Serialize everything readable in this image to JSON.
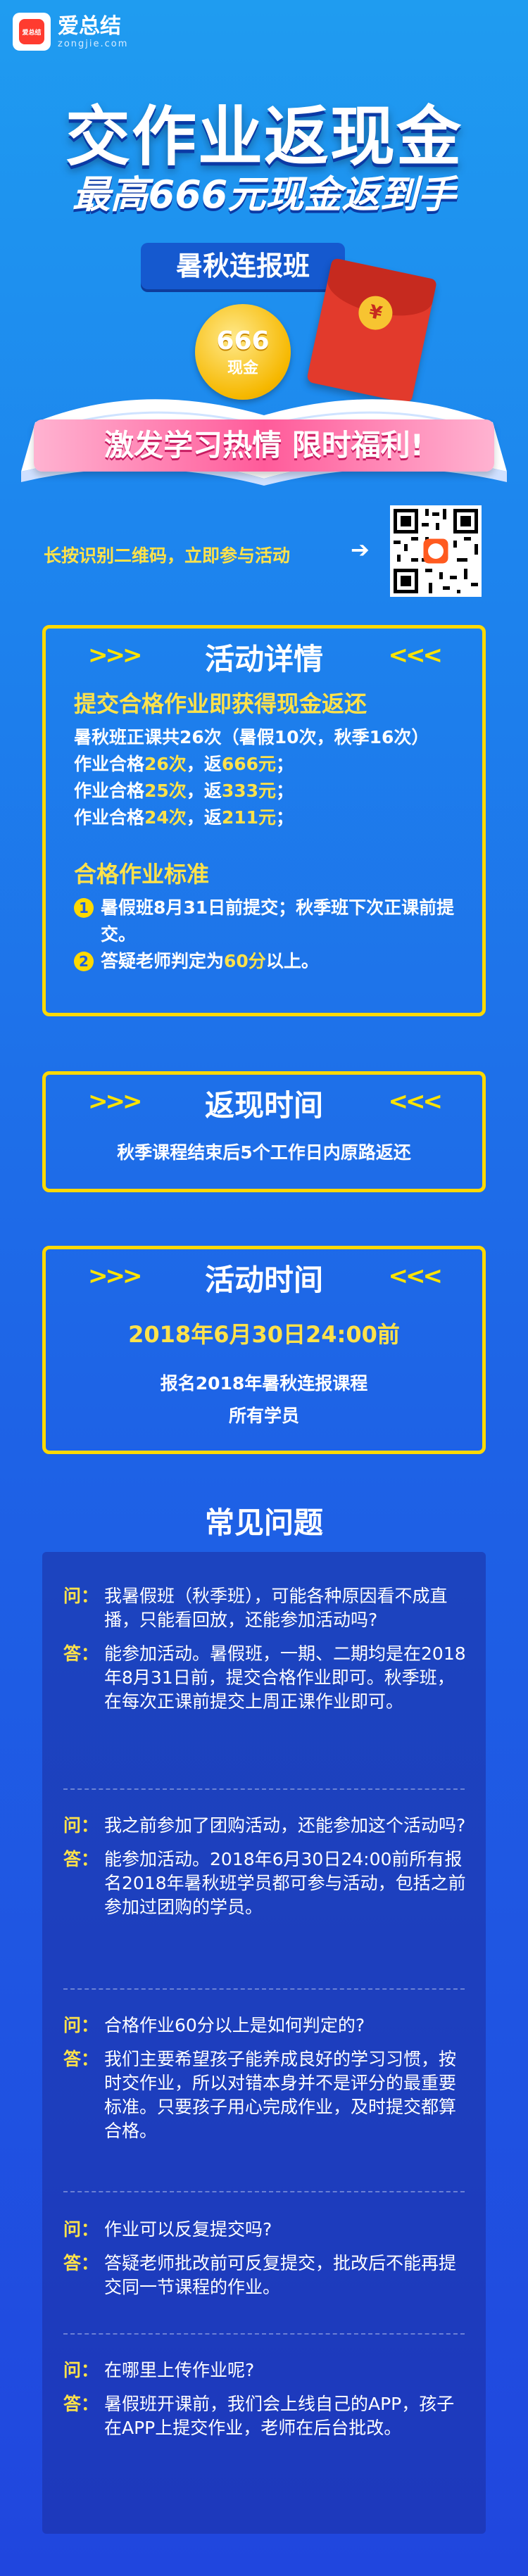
{
  "brand": {
    "name": "爱总结",
    "domain": "zongjie.com",
    "badge": "爱总结"
  },
  "hero": {
    "title": "交作业返现金",
    "subtitle": "最高666元现金返到手",
    "class_tag": "暑秋连报班",
    "coin_amount": "666",
    "coin_unit": "现金",
    "envelope_symbol": "¥",
    "banner": "激发学习热情  限时福利!"
  },
  "qr_prompt": {
    "text": "长按识别二维码，立即参与活动",
    "arrow": "➔"
  },
  "activity": {
    "title": "活动详情",
    "h1": "提交合格作业即获得现金返还",
    "lines": [
      {
        "pre": "暑秋班正课共26次（暑假10次，秋季16次）"
      },
      {
        "pre": "作业合格",
        "a": "26次",
        "mid": "，返",
        "b": "666元",
        "post": "；"
      },
      {
        "pre": "作业合格",
        "a": "25次",
        "mid": "，返",
        "b": "333元",
        "post": "；"
      },
      {
        "pre": "作业合格",
        "a": "24次",
        "mid": "，返",
        "b": "211元",
        "post": "；"
      }
    ],
    "h2": "合格作业标准",
    "rules": [
      {
        "n": "1",
        "text": "暑假班8月31日前提交；秋季班下次正课前提交。"
      },
      {
        "n": "2",
        "pre": "答疑老师判定为",
        "hl": "60分",
        "post": "以上。"
      }
    ]
  },
  "refund": {
    "title": "返现时间",
    "text": "秋季课程结束后5个工作日内原路返还"
  },
  "period": {
    "title": "活动时间",
    "deadline": "2018年6月30日24:00前",
    "l1": "报名2018年暑秋连报课程",
    "l2": "所有学员"
  },
  "faq": {
    "title": "常见问题",
    "q_label": "问：",
    "a_label": "答：",
    "items": [
      {
        "q": "我暑假班（秋季班），可能各种原因看不成直播，只能看回放，还能参加活动吗?",
        "a": "能参加活动。暑假班，一期、二期均是在2018年8月31日前，提交合格作业即可。秋季班，在每次正课前提交上周正课作业即可。"
      },
      {
        "q": "我之前参加了团购活动，还能参加这个活动吗?",
        "a": "能参加活动。2018年6月30日24:00前所有报名2018年暑秋班学员都可参与活动，包括之前参加过团购的学员。"
      },
      {
        "q": "合格作业60分以上是如何判定的?",
        "a": "我们主要希望孩子能养成良好的学习习惯，按时交作业，所以对错本身并不是评分的最重要标准。只要孩子用心完成作业，及时提交都算合格。"
      },
      {
        "q": "作业可以反复提交吗?",
        "a": "答疑老师批改前可反复提交，批改后不能再提交同一节课程的作业。"
      },
      {
        "q": "在哪里上传作业呢?",
        "a": "暑假班开课前，我们会上线自己的APP，孩子在APP上提交作业，老师在后台批改。"
      }
    ]
  },
  "colors": {
    "accent_yellow": "#ffe24a",
    "border_yellow": "#ffd900",
    "bg_blue": "#1e63e6"
  }
}
